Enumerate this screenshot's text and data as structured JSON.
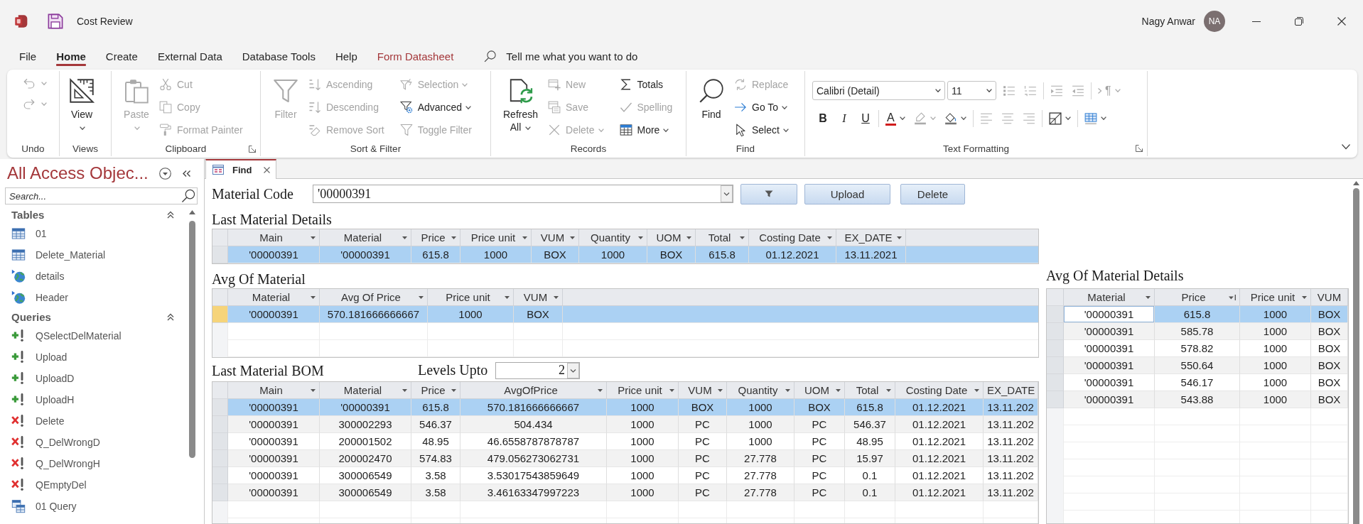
{
  "window": {
    "title": "Cost Review",
    "user": "Nagy Anwar",
    "initials": "NA"
  },
  "menu_tabs": [
    {
      "label": "File",
      "kind": "standard",
      "selected": false
    },
    {
      "label": "Home",
      "kind": "standard",
      "selected": true
    },
    {
      "label": "Create",
      "kind": "standard",
      "selected": false
    },
    {
      "label": "External Data",
      "kind": "standard",
      "selected": false
    },
    {
      "label": "Database Tools",
      "kind": "standard",
      "selected": false
    },
    {
      "label": "Help",
      "kind": "standard",
      "selected": false
    },
    {
      "label": "Form Datasheet",
      "kind": "contextual",
      "selected": false
    }
  ],
  "tell_me": {
    "placeholder": "Tell me what you want to do"
  },
  "ribbon": {
    "groups": [
      {
        "label": "Undo",
        "launcher": false,
        "columns": [
          [
            {
              "kind": "icon",
              "disabled": true,
              "dropdown": true
            },
            {
              "kind": "icon",
              "disabled": true,
              "dropdown": true
            }
          ]
        ]
      },
      {
        "label": "Views",
        "launcher": false,
        "columns": [
          [
            {
              "kind": "large",
              "label": "View",
              "disabled": false,
              "dropdown": true
            }
          ]
        ]
      },
      {
        "label": "Clipboard",
        "launcher": true,
        "columns": [
          [
            {
              "kind": "large",
              "label": "Paste",
              "disabled": true,
              "dropdown": true
            }
          ],
          [
            {
              "kind": "small",
              "label": "Cut",
              "disabled": true,
              "dropdown": false
            },
            {
              "kind": "small",
              "label": "Copy",
              "disabled": true,
              "dropdown": false
            },
            {
              "kind": "small",
              "label": "Format Painter",
              "disabled": true,
              "dropdown": false
            }
          ]
        ]
      },
      {
        "label": "Sort & Filter",
        "launcher": false,
        "columns": [
          [
            {
              "kind": "large",
              "label": "Filter",
              "disabled": true,
              "dropdown": false
            }
          ],
          [
            {
              "kind": "small",
              "label": "Ascending",
              "disabled": true,
              "dropdown": false
            },
            {
              "kind": "small",
              "label": "Descending",
              "disabled": true,
              "dropdown": false
            },
            {
              "kind": "small",
              "label": "Remove Sort",
              "disabled": true,
              "dropdown": false
            }
          ],
          [
            {
              "kind": "small",
              "label": "Selection",
              "disabled": true,
              "dropdown": true
            },
            {
              "kind": "small",
              "label": "Advanced",
              "disabled": false,
              "dropdown": true
            },
            {
              "kind": "small",
              "label": "Toggle Filter",
              "disabled": true,
              "dropdown": false
            }
          ]
        ]
      },
      {
        "label": "Records",
        "launcher": false,
        "columns": [
          [
            {
              "kind": "large",
              "label": "Refresh All",
              "disabled": false,
              "dropdown": true
            }
          ],
          [
            {
              "kind": "small",
              "label": "New",
              "disabled": true,
              "dropdown": false
            },
            {
              "kind": "small",
              "label": "Save",
              "disabled": true,
              "dropdown": false
            },
            {
              "kind": "small",
              "label": "Delete",
              "disabled": true,
              "dropdown": true
            }
          ],
          [
            {
              "kind": "small",
              "label": "Totals",
              "disabled": false,
              "dropdown": false
            },
            {
              "kind": "small",
              "label": "Spelling",
              "disabled": true,
              "dropdown": false
            },
            {
              "kind": "small",
              "label": "More",
              "disabled": false,
              "dropdown": true
            }
          ]
        ]
      },
      {
        "label": "Find",
        "launcher": false,
        "columns": [
          [
            {
              "kind": "large",
              "label": "Find",
              "disabled": false,
              "dropdown": false
            }
          ],
          [
            {
              "kind": "small",
              "label": "Replace",
              "disabled": true,
              "dropdown": false
            },
            {
              "kind": "small",
              "label": "Go To",
              "disabled": false,
              "dropdown": true
            },
            {
              "kind": "small",
              "label": "Select",
              "disabled": false,
              "dropdown": true
            }
          ]
        ]
      },
      {
        "label": "Text Formatting",
        "launcher": true,
        "upper_controls": [
          {
            "kind": "combo",
            "value": "Calibri (Detail)"
          },
          {
            "kind": "combo",
            "value": "11"
          },
          {
            "kind": "icon",
            "disabled": true,
            "dropdown": false
          },
          {
            "kind": "icon",
            "disabled": true,
            "dropdown": false
          },
          {
            "kind": "separator"
          },
          {
            "kind": "icon",
            "disabled": true,
            "dropdown": false
          },
          {
            "kind": "icon",
            "disabled": true,
            "dropdown": false
          },
          {
            "kind": "separator"
          },
          {
            "kind": "paragraph",
            "label": "¶",
            "disabled": true,
            "dropdown": true
          }
        ],
        "lower_controls": [
          {
            "kind": "bold",
            "label": "B",
            "disabled": false,
            "dropdown": false
          },
          {
            "kind": "italic",
            "label": "I",
            "disabled": false,
            "dropdown": false
          },
          {
            "kind": "underline",
            "label": "U",
            "disabled": false,
            "dropdown": false
          },
          {
            "kind": "separator"
          },
          {
            "kind": "font_color",
            "label": "A",
            "disabled": false,
            "dropdown": true
          },
          {
            "kind": "icon",
            "disabled": true,
            "dropdown": true
          },
          {
            "kind": "icon",
            "disabled": false,
            "dropdown": true
          },
          {
            "kind": "separator"
          },
          {
            "kind": "icon",
            "disabled": true,
            "dropdown": false
          },
          {
            "kind": "icon",
            "disabled": true,
            "dropdown": false
          },
          {
            "kind": "icon",
            "disabled": true,
            "dropdown": false
          },
          {
            "kind": "separator"
          },
          {
            "kind": "icon",
            "disabled": false,
            "dropdown": true
          },
          {
            "kind": "separator"
          },
          {
            "kind": "icon",
            "disabled": false,
            "dropdown": true
          }
        ]
      }
    ]
  },
  "navigation_pane": {
    "title": "All Access Objec...",
    "search": {
      "placeholder": "Search..."
    },
    "groups": [
      {
        "label": "Tables",
        "expanded": true,
        "items": [
          {
            "label": "01",
            "kind": "table"
          },
          {
            "label": "Delete_Material",
            "kind": "table"
          },
          {
            "label": "details",
            "kind": "linked_table"
          },
          {
            "label": "Header",
            "kind": "linked_table"
          }
        ]
      },
      {
        "label": "Queries",
        "expanded": true,
        "items": [
          {
            "label": "QSelectDelMaterial",
            "kind": "append_query"
          },
          {
            "label": "Upload",
            "kind": "append_query"
          },
          {
            "label": "UploadD",
            "kind": "append_query"
          },
          {
            "label": "UploadH",
            "kind": "append_query"
          },
          {
            "label": "Delete",
            "kind": "delete_query"
          },
          {
            "label": "Q_DelWrongD",
            "kind": "delete_query"
          },
          {
            "label": "Q_DelWrongH",
            "kind": "delete_query"
          },
          {
            "label": "QEmptyDel",
            "kind": "delete_query"
          },
          {
            "label": "01 Query",
            "kind": "select_query"
          }
        ]
      }
    ]
  },
  "document_tabs": [
    {
      "label": "Find",
      "selected": true
    }
  ],
  "form": {
    "material_code": {
      "label": "Material Code",
      "value": "'00000391"
    },
    "buttons": [
      {
        "kind": "filter"
      },
      {
        "kind": "text",
        "label": "Upload"
      },
      {
        "kind": "text",
        "label": "Delete"
      }
    ],
    "last_material_details": {
      "title": "Last Material Details",
      "columns": [
        {
          "label": "Main",
          "dropdown": true
        },
        {
          "label": "Material",
          "dropdown": true
        },
        {
          "label": "Price",
          "dropdown": true
        },
        {
          "label": "Price unit",
          "dropdown": true
        },
        {
          "label": "VUM",
          "dropdown": true
        },
        {
          "label": "Quantity",
          "dropdown": true
        },
        {
          "label": "UOM",
          "dropdown": true
        },
        {
          "label": "Total",
          "dropdown": true
        },
        {
          "label": "Costing Date",
          "dropdown": true
        },
        {
          "label": "EX_DATE",
          "dropdown": true
        }
      ],
      "rows": [
        {
          "selected": true,
          "cells": [
            "'00000391",
            "'00000391",
            "615.8",
            "1000",
            "BOX",
            "1000",
            "BOX",
            "615.8",
            "01.12.2021",
            "13.11.2021"
          ]
        }
      ]
    },
    "avg_of_material": {
      "title": "Avg Of Material",
      "columns": [
        {
          "label": "Material",
          "dropdown": true
        },
        {
          "label": "Avg Of Price",
          "dropdown": true
        },
        {
          "label": "Price unit",
          "dropdown": true
        },
        {
          "label": "VUM",
          "dropdown": true
        }
      ],
      "rows": [
        {
          "selected": true,
          "current": true,
          "cells": [
            "'00000391",
            "570.181666666667",
            "1000",
            "BOX"
          ]
        }
      ]
    },
    "last_material_bom": {
      "title": "Last Material BOM",
      "levels_upto": {
        "label": "Levels Upto",
        "value": "2"
      },
      "columns": [
        {
          "label": "Main",
          "dropdown": true
        },
        {
          "label": "Material",
          "dropdown": true
        },
        {
          "label": "Price",
          "dropdown": true
        },
        {
          "label": "AvgOfPrice",
          "dropdown": true
        },
        {
          "label": "Price unit",
          "dropdown": true
        },
        {
          "label": "VUM",
          "dropdown": true
        },
        {
          "label": "Quantity",
          "dropdown": true
        },
        {
          "label": "UOM",
          "dropdown": true
        },
        {
          "label": "Total",
          "dropdown": true
        },
        {
          "label": "Costing Date",
          "dropdown": true
        },
        {
          "label": "EX_DATE",
          "dropdown": false
        }
      ],
      "rows": [
        {
          "selected": true,
          "cells": [
            "'00000391",
            "'00000391",
            "615.8",
            "570.181666666667",
            "1000",
            "BOX",
            "1000",
            "BOX",
            "615.8",
            "01.12.2021",
            "13.11.202"
          ]
        },
        {
          "selected": false,
          "cells": [
            "'00000391",
            "300002293",
            "546.37",
            "504.434",
            "1000",
            "PC",
            "1000",
            "PC",
            "546.37",
            "01.12.2021",
            "13.11.202"
          ]
        },
        {
          "selected": false,
          "cells": [
            "'00000391",
            "200001502",
            "48.95",
            "46.6558787878787",
            "1000",
            "PC",
            "1000",
            "PC",
            "48.95",
            "01.12.2021",
            "13.11.202"
          ]
        },
        {
          "selected": false,
          "cells": [
            "'00000391",
            "200002470",
            "574.83",
            "479.056273062731",
            "1000",
            "PC",
            "27.778",
            "PC",
            "15.97",
            "01.12.2021",
            "13.11.202"
          ]
        },
        {
          "selected": false,
          "cells": [
            "'00000391",
            "300006549",
            "3.58",
            "3.53017543859649",
            "1000",
            "PC",
            "27.778",
            "PC",
            "0.1",
            "01.12.2021",
            "13.11.202"
          ]
        },
        {
          "selected": false,
          "cells": [
            "'00000391",
            "300006549",
            "3.58",
            "3.46163347997223",
            "1000",
            "PC",
            "27.778",
            "PC",
            "0.1",
            "01.12.2021",
            "13.11.202"
          ]
        }
      ]
    },
    "avg_of_material_details": {
      "title": "Avg Of Material Details",
      "columns": [
        {
          "label": "Material",
          "dropdown": true,
          "sorted": false
        },
        {
          "label": "Price",
          "dropdown": true,
          "sorted": true
        },
        {
          "label": "Price unit",
          "dropdown": true,
          "sorted": false
        },
        {
          "label": "VUM",
          "dropdown": false,
          "sorted": false
        }
      ],
      "rows": [
        {
          "selected": true,
          "cells": [
            {
              "text": "'00000391",
              "focused": true
            },
            {
              "text": "615.8",
              "focused": false
            },
            {
              "text": "1000",
              "focused": false
            },
            {
              "text": "BOX",
              "focused": false
            }
          ]
        },
        {
          "selected": false,
          "cells": [
            {
              "text": "'00000391",
              "focused": false
            },
            {
              "text": "585.78",
              "focused": false
            },
            {
              "text": "1000",
              "focused": false
            },
            {
              "text": "BOX",
              "focused": false
            }
          ]
        },
        {
          "selected": false,
          "cells": [
            {
              "text": "'00000391",
              "focused": false
            },
            {
              "text": "578.82",
              "focused": false
            },
            {
              "text": "1000",
              "focused": false
            },
            {
              "text": "BOX",
              "focused": false
            }
          ]
        },
        {
          "selected": false,
          "cells": [
            {
              "text": "'00000391",
              "focused": false
            },
            {
              "text": "550.64",
              "focused": false
            },
            {
              "text": "1000",
              "focused": false
            },
            {
              "text": "BOX",
              "focused": false
            }
          ]
        },
        {
          "selected": false,
          "cells": [
            {
              "text": "'00000391",
              "focused": false
            },
            {
              "text": "546.17",
              "focused": false
            },
            {
              "text": "1000",
              "focused": false
            },
            {
              "text": "BOX",
              "focused": false
            }
          ]
        },
        {
          "selected": false,
          "cells": [
            {
              "text": "'00000391",
              "focused": false
            },
            {
              "text": "543.88",
              "focused": false
            },
            {
              "text": "1000",
              "focused": false
            },
            {
              "text": "BOX",
              "focused": false
            }
          ]
        }
      ]
    }
  }
}
